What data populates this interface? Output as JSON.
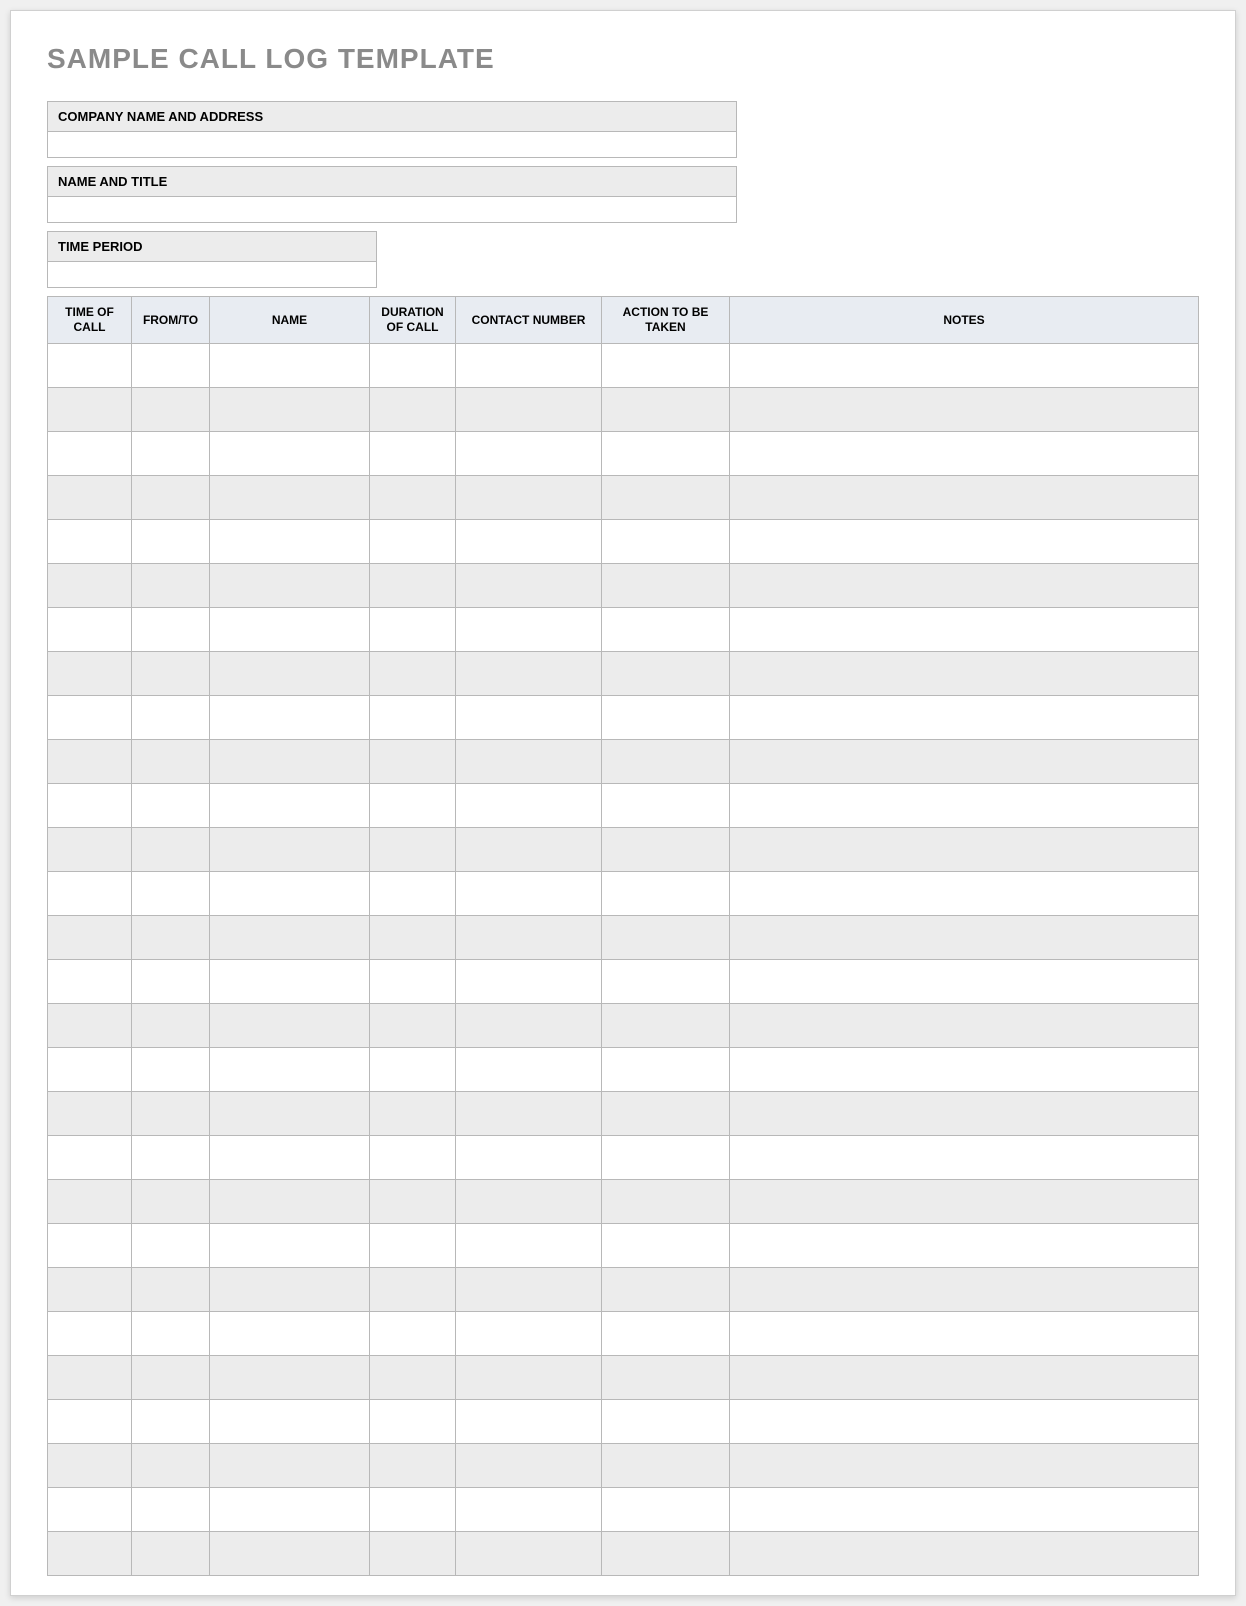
{
  "title": "SAMPLE CALL LOG TEMPLATE",
  "header": {
    "company_label": "COMPANY NAME AND ADDRESS",
    "company_value": "",
    "name_label": "NAME AND TITLE",
    "name_value": "",
    "period_label": "TIME PERIOD",
    "period_value": ""
  },
  "table": {
    "columns": [
      "TIME OF CALL",
      "FROM/TO",
      "NAME",
      "DURATION OF CALL",
      "CONTACT NUMBER",
      "ACTION TO BE TAKEN",
      "NOTES"
    ],
    "rows": [
      [
        "",
        "",
        "",
        "",
        "",
        "",
        ""
      ],
      [
        "",
        "",
        "",
        "",
        "",
        "",
        ""
      ],
      [
        "",
        "",
        "",
        "",
        "",
        "",
        ""
      ],
      [
        "",
        "",
        "",
        "",
        "",
        "",
        ""
      ],
      [
        "",
        "",
        "",
        "",
        "",
        "",
        ""
      ],
      [
        "",
        "",
        "",
        "",
        "",
        "",
        ""
      ],
      [
        "",
        "",
        "",
        "",
        "",
        "",
        ""
      ],
      [
        "",
        "",
        "",
        "",
        "",
        "",
        ""
      ],
      [
        "",
        "",
        "",
        "",
        "",
        "",
        ""
      ],
      [
        "",
        "",
        "",
        "",
        "",
        "",
        ""
      ],
      [
        "",
        "",
        "",
        "",
        "",
        "",
        ""
      ],
      [
        "",
        "",
        "",
        "",
        "",
        "",
        ""
      ],
      [
        "",
        "",
        "",
        "",
        "",
        "",
        ""
      ],
      [
        "",
        "",
        "",
        "",
        "",
        "",
        ""
      ],
      [
        "",
        "",
        "",
        "",
        "",
        "",
        ""
      ],
      [
        "",
        "",
        "",
        "",
        "",
        "",
        ""
      ],
      [
        "",
        "",
        "",
        "",
        "",
        "",
        ""
      ],
      [
        "",
        "",
        "",
        "",
        "",
        "",
        ""
      ],
      [
        "",
        "",
        "",
        "",
        "",
        "",
        ""
      ],
      [
        "",
        "",
        "",
        "",
        "",
        "",
        ""
      ],
      [
        "",
        "",
        "",
        "",
        "",
        "",
        ""
      ],
      [
        "",
        "",
        "",
        "",
        "",
        "",
        ""
      ],
      [
        "",
        "",
        "",
        "",
        "",
        "",
        ""
      ],
      [
        "",
        "",
        "",
        "",
        "",
        "",
        ""
      ],
      [
        "",
        "",
        "",
        "",
        "",
        "",
        ""
      ],
      [
        "",
        "",
        "",
        "",
        "",
        "",
        ""
      ],
      [
        "",
        "",
        "",
        "",
        "",
        "",
        ""
      ],
      [
        "",
        "",
        "",
        "",
        "",
        "",
        ""
      ]
    ]
  }
}
